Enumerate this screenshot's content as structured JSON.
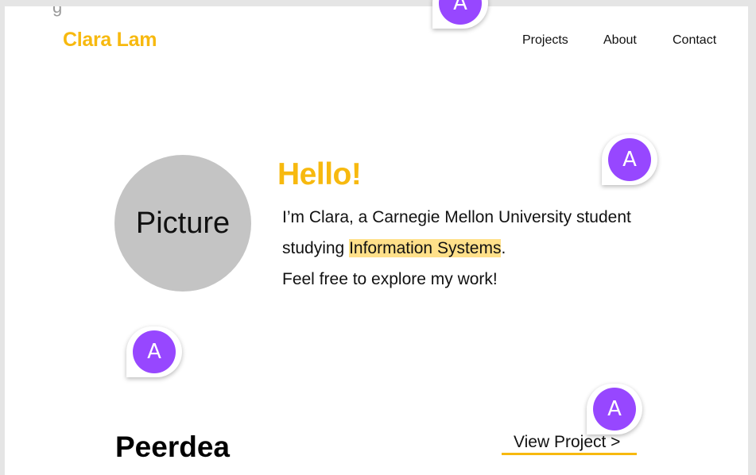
{
  "header": {
    "logo": "Clara Lam",
    "nav": [
      "Projects",
      "About",
      "Contact"
    ]
  },
  "hero": {
    "picture_label": "Picture",
    "greeting": "Hello!",
    "intro_before": "I’m Clara, a Carnegie Mellon University student studying ",
    "intro_highlight": "Information Systems",
    "intro_after": ".",
    "intro_line2": "Feel free to explore my work!"
  },
  "project": {
    "title": "Peerdea",
    "link": "View Project >"
  },
  "comment_markers": [
    "A",
    "A",
    "A",
    "A"
  ],
  "colors": {
    "accent": "#f7b90f",
    "highlight": "#ffe08a",
    "marker": "#9747ff",
    "placeholder": "#c4c4c4"
  }
}
